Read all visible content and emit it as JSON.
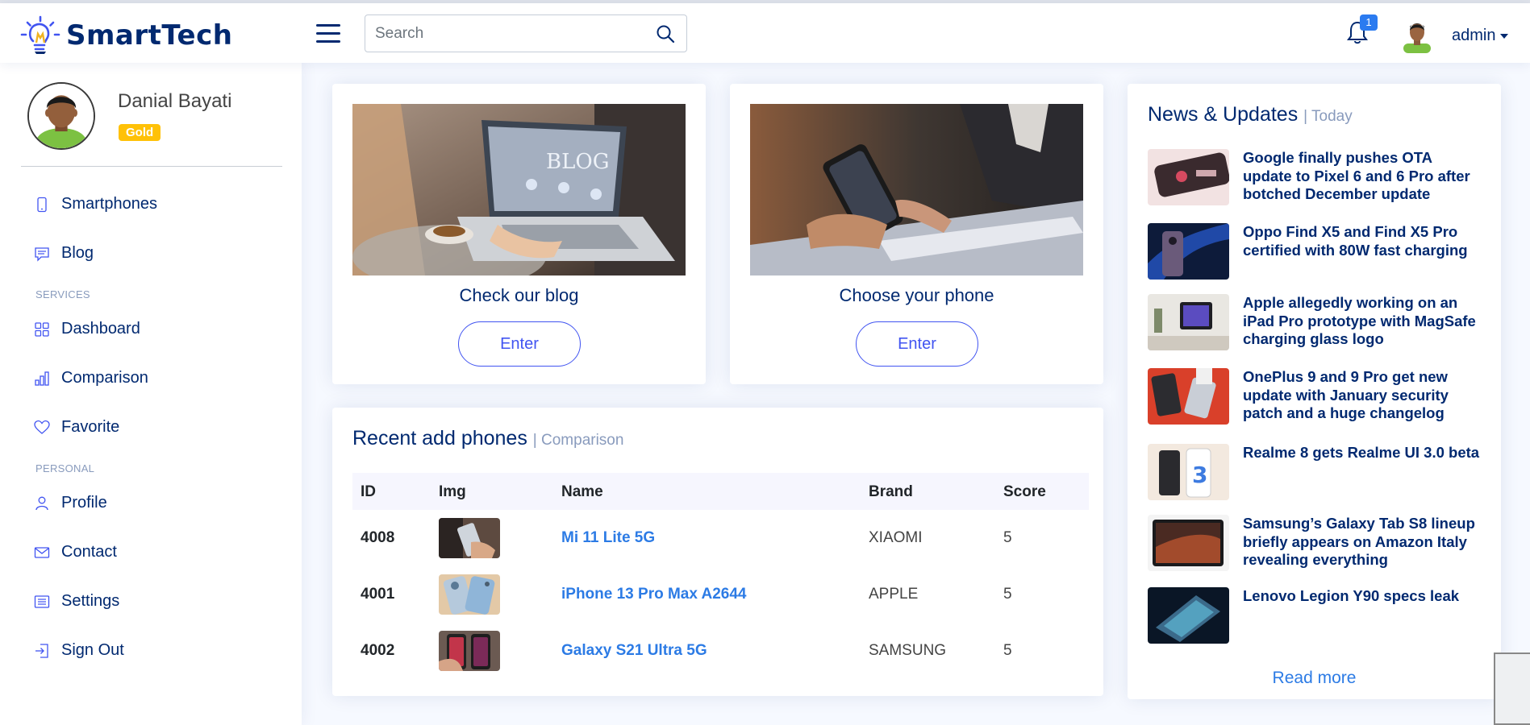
{
  "app": {
    "name": "SmartTech"
  },
  "header": {
    "search_placeholder": "Search",
    "notification_count": "1",
    "user_label": "admin"
  },
  "sidebar": {
    "profile": {
      "name": "Danial Bayati",
      "badge": "Gold"
    },
    "items": [
      {
        "label": "Smartphones",
        "icon": "phone-icon"
      },
      {
        "label": "Blog",
        "icon": "chat-square-icon"
      },
      {
        "label": "Dashboard",
        "icon": "grid-icon"
      },
      {
        "label": "Comparison",
        "icon": "bar-chart-icon"
      },
      {
        "label": "Favorite",
        "icon": "heart-icon"
      },
      {
        "label": "Profile",
        "icon": "person-icon"
      },
      {
        "label": "Contact",
        "icon": "envelope-icon"
      },
      {
        "label": "Settings",
        "icon": "list-icon"
      },
      {
        "label": "Sign Out",
        "icon": "sign-out-icon"
      }
    ],
    "headings": {
      "services": "SERVICES",
      "personal": "PERSONAL"
    }
  },
  "promos": [
    {
      "title": "Check our blog",
      "button": "Enter",
      "image_text": "BLOG"
    },
    {
      "title": "Choose your phone",
      "button": "Enter"
    }
  ],
  "recent_phones": {
    "title": "Recent add phones",
    "subtitle": "| Comparison",
    "columns": [
      "ID",
      "Img",
      "Name",
      "Brand",
      "Score"
    ],
    "rows": [
      {
        "id": "4008",
        "name": "Mi 11 Lite 5G",
        "brand": "XIAOMI",
        "score": "5"
      },
      {
        "id": "4001",
        "name": "iPhone 13 Pro Max A2644",
        "brand": "APPLE",
        "score": "5"
      },
      {
        "id": "4002",
        "name": "Galaxy S21 Ultra 5G",
        "brand": "SAMSUNG",
        "score": "5"
      }
    ]
  },
  "news": {
    "title": "News & Updates",
    "subtitle": "| Today",
    "items": [
      {
        "text": "Google finally pushes OTA update to Pixel 6 and 6 Pro after botched December update"
      },
      {
        "text": "Oppo Find X5 and Find X5 Pro certified with 80W fast charging"
      },
      {
        "text": "Apple allegedly working on an iPad Pro prototype with MagSafe charging glass logo"
      },
      {
        "text": "OnePlus 9 and 9 Pro get new update with January security patch and a huge changelog"
      },
      {
        "text": "Realme 8 gets Realme UI 3.0 beta"
      },
      {
        "text": "Samsung’s Galaxy Tab S8 lineup briefly appears on Amazon Italy revealing everything"
      },
      {
        "text": "Lenovo Legion Y90 specs leak"
      }
    ],
    "read_more": "Read more"
  },
  "colors": {
    "brand": "#012970",
    "accent": "#4154f1",
    "link": "#2c7be5",
    "badge_gold": "#ffc107"
  }
}
